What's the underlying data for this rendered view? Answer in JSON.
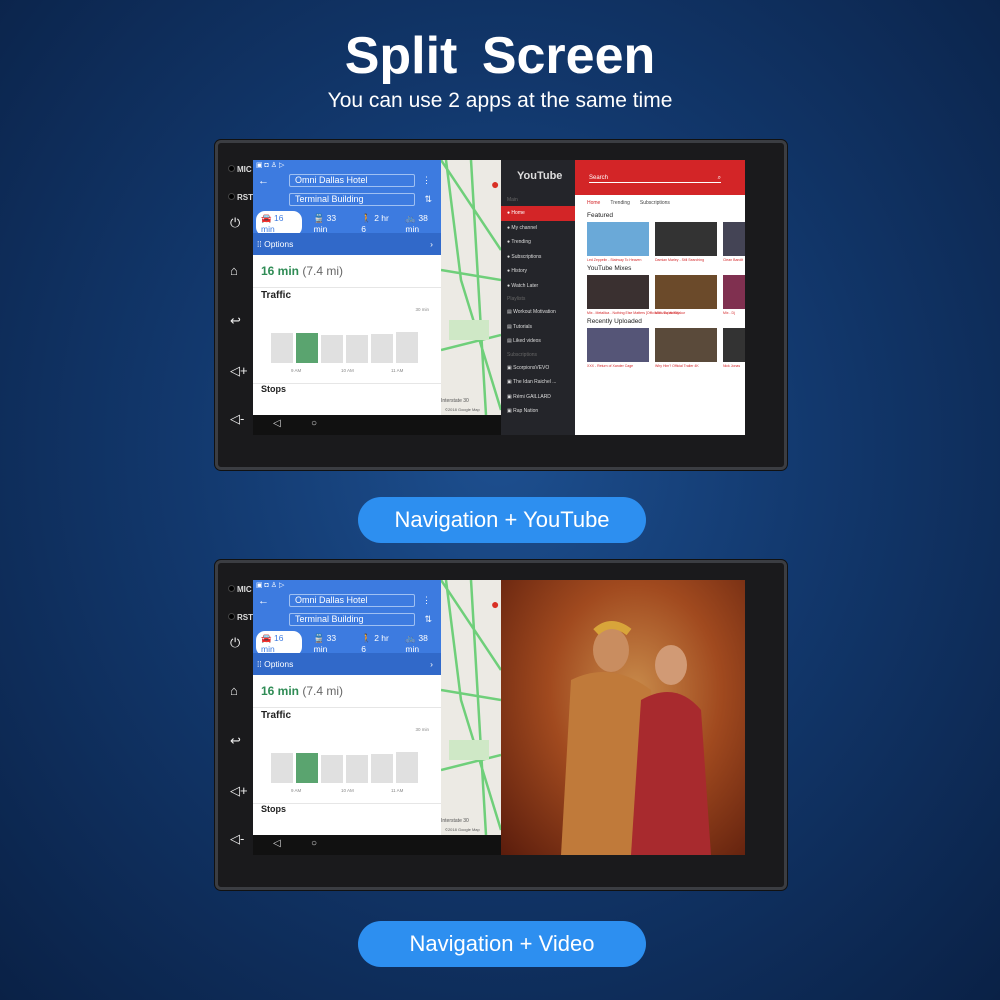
{
  "header": {
    "title": "Split Screen",
    "subtitle": "You can use 2 apps at the same time"
  },
  "device": {
    "mic_label": "MIC",
    "rst_label": "RST"
  },
  "navigation": {
    "origin": "Omni Dallas Hotel",
    "destination": "Terminal Building",
    "modes": [
      {
        "icon": "car-icon",
        "label": "16 min",
        "selected": true
      },
      {
        "icon": "transit-icon",
        "label": "33 min"
      },
      {
        "icon": "walk-icon",
        "label": "2 hr 6"
      },
      {
        "icon": "bike-icon",
        "label": "38 min"
      }
    ],
    "options_label": "Options",
    "eta_time": "16 min",
    "eta_distance": "(7.4 mi)",
    "traffic_label": "Traffic",
    "traffic_max": "30 min",
    "traffic_levels": [
      0.8,
      0.78,
      0.75,
      0.75,
      0.76,
      0.82
    ],
    "current_index": 1,
    "time_ticks": [
      "9 AM",
      "10 AM",
      "11 AM"
    ],
    "stops_label": "Stops",
    "map_label": "Interstate 30",
    "map_copyright": "©2018 Google  Map"
  },
  "youtube": {
    "logo": "YouTube",
    "search_placeholder": "Search",
    "sidebar": {
      "main_heading": "Main",
      "main": [
        "Home",
        "My channel",
        "Trending",
        "Subscriptions",
        "History",
        "Watch Later"
      ],
      "playlists_heading": "Playlists",
      "playlists": [
        "Workout Motivation",
        "Tutorials",
        "Liked videos"
      ],
      "subscriptions_heading": "Subscriptions",
      "subscriptions": [
        "ScorpionsVEVO",
        "The Idan Raichel ...",
        "Rémi GAILLARD",
        "Rap Nation"
      ]
    },
    "tabs": [
      "Home",
      "Trending",
      "Subscriptions"
    ],
    "sections": [
      {
        "title": "Featured",
        "videos": [
          "Led Zeppelin - Stairway To Heaven",
          "Damian Marley - Still Searching",
          "Clean Bandit"
        ]
      },
      {
        "title": "YouTube Mixes",
        "videos": [
          "Mix - Metallica - Nothing Else Matters [Official Music Video]",
          "Mix - Tupac Shakur",
          "Mix - Dj"
        ]
      },
      {
        "title": "Recently Uploaded",
        "videos": [
          "XXX - Return of Xander Cage",
          "Why Him? Official Trailer 4K",
          "Nick Jonas"
        ]
      }
    ]
  },
  "captions": {
    "first": "Navigation + YouTube",
    "second": "Navigation + Video"
  },
  "colors": {
    "accent": "#2d8ff0",
    "youtube_red": "#d32527",
    "maps_blue": "#3d7be0",
    "eta_green": "#2f8c55"
  }
}
